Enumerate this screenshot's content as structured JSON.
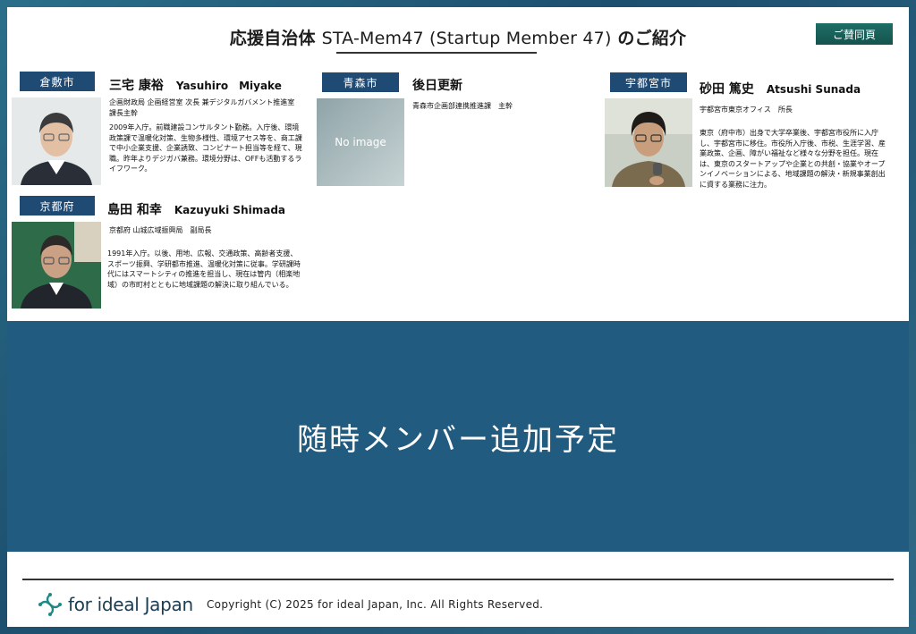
{
  "header": {
    "title_jp": "応援自治体",
    "title_en": "STA-Mem47 (Startup Member 47)",
    "title_suffix": "のご紹介",
    "support_button": "ご賛同頁"
  },
  "members": [
    {
      "city": "倉敷市",
      "name_jp": "三宅 康裕",
      "name_en": "Yasuhiro　Miyake",
      "role": "企画財政局 企画経営室 次長 兼デジタルガバメント推進室 課長主幹",
      "bio": "2009年入庁。前職建設コンサルタント勤務。入庁後、環境政策課で温暖化対策、生物多様性、環境アセス等を、商工課で中小企業支援、企業誘致、コンビナート担当等を経て、現職。昨年よりデジガバ兼務。環境分野は、OFFも活動するライフワーク。",
      "photo": "portrait"
    },
    {
      "city": "青森市",
      "name_jp": "後日更新",
      "name_en": "",
      "role": "青森市企画部連携推進課　主幹",
      "bio": "",
      "photo": "No image"
    },
    {
      "city": "宇都宮市",
      "name_jp": "砂田 篤史",
      "name_en": "Atsushi Sunada",
      "role": "宇都宮市東京オフィス　所長",
      "bio": "東京（府中市）出身で大学卒業後、宇都宮市役所に入庁し、宇都宮市に移住。市役所入庁後、市税、生涯学習、産業政策、企画、障がい福祉など様々な分野を担任。現在は、東京のスタートアップや企業との共創・協業やオープンイノベーションによる、地域課題の解決・新規事業創出に資する業務に注力。",
      "photo": "portrait"
    },
    {
      "city": "京都府",
      "name_jp": "島田 和幸",
      "name_en": "Kazuyuki Shimada",
      "role": "京都府 山城広域振興局　副局長",
      "bio": "1991年入庁。以後、用地、広報、交通政策、高齢者支援、スポーツ振興、学研都市推進、温暖化対策に従事。学研課時代にはスマートシティの推進を担当し、現在は管内（相楽地域）の市町村とともに地域課題の解決に取り組んでいる。",
      "photo": "portrait"
    }
  ],
  "banner": {
    "text": "随時メンバー追加予定"
  },
  "footer": {
    "logo_text": "for ideal Japan",
    "copyright": "Copyright (C) 2025 for ideal Japan, Inc. All Rights Reserved."
  },
  "colors": {
    "tag": "#1f4a73",
    "banner": "#215b7f",
    "button": "#1e6e67"
  }
}
